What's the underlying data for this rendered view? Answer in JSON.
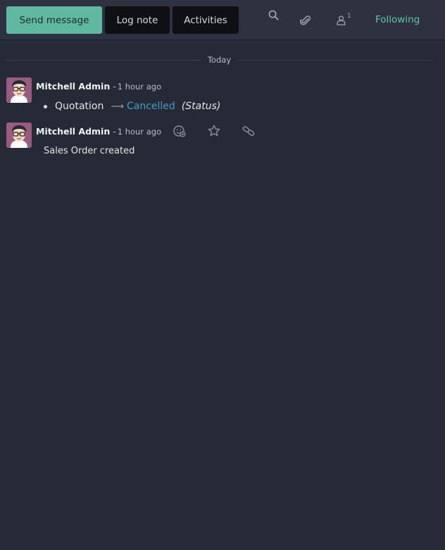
{
  "topbar": {
    "send_message": "Send message",
    "log_note": "Log note",
    "activities": "Activities",
    "follower_count": "1",
    "following": "Following"
  },
  "separator": {
    "label": "Today"
  },
  "messages": [
    {
      "author": "Mitchell Admin",
      "dash": "-",
      "time": "1 hour ago",
      "tracking": {
        "old_value": "Quotation",
        "arrow": "⟶",
        "new_value": "Cancelled",
        "field": "(Status)"
      }
    },
    {
      "author": "Mitchell Admin",
      "dash": "-",
      "time": "1 hour ago",
      "body": "Sales Order created"
    }
  ],
  "colors": {
    "background": "#262a36",
    "topbar": "#2d3140",
    "primary": "#5fb8a0",
    "following": "#5fc7a2",
    "tracking_new_value": "#3d9fc7"
  },
  "icons": [
    "search-icon",
    "paperclip-icon",
    "user-icon",
    "add-reaction-icon",
    "star-icon",
    "link-icon"
  ]
}
